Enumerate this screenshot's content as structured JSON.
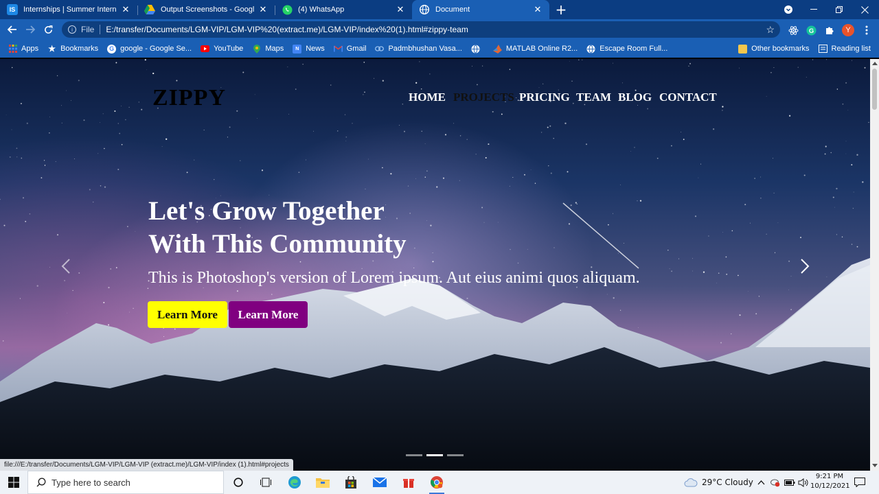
{
  "browser": {
    "tabs": [
      {
        "title": "Internships | Summer Internship",
        "favicon": "IS",
        "favicon_color": "#1e88e5",
        "close": "✕"
      },
      {
        "title": "Output Screenshots - Google Dri",
        "favicon": "drive",
        "favicon_color": "#fbbc04",
        "close": "✕"
      },
      {
        "title": "(4) WhatsApp",
        "favicon": "whatsapp",
        "favicon_color": "#25d366",
        "close": "✕"
      },
      {
        "title": "Document",
        "favicon": "globe",
        "favicon_color": "#ffffff",
        "close": "✕",
        "active": true
      }
    ],
    "new_tab": "+",
    "address": {
      "scheme": "File",
      "url": "E:/transfer/Documents/LGM-VIP/LGM-VIP%20(extract.me)/LGM-VIP/index%20(1).html#zippy-team"
    },
    "profile_initial": "Y",
    "bookmarks": [
      {
        "label": "Apps",
        "icon": "apps-grid-icon"
      },
      {
        "label": "Bookmarks",
        "icon": "star-icon"
      },
      {
        "label": "google - Google Se...",
        "icon": "google-icon"
      },
      {
        "label": "YouTube",
        "icon": "youtube-icon"
      },
      {
        "label": "Maps",
        "icon": "maps-icon"
      },
      {
        "label": "News",
        "icon": "news-icon"
      },
      {
        "label": "Gmail",
        "icon": "gmail-icon"
      },
      {
        "label": "Padmbhushan Vasa...",
        "icon": "link-icon"
      },
      {
        "label": "",
        "icon": "globe-icon"
      },
      {
        "label": "MATLAB Online R2...",
        "icon": "matlab-icon"
      },
      {
        "label": "Escape Room Full...",
        "icon": "globe-icon"
      }
    ],
    "bookmarks_right": [
      {
        "label": "Other bookmarks",
        "icon": "folder-icon"
      },
      {
        "label": "Reading list",
        "icon": "reading-list-icon"
      }
    ],
    "status_url": "file:///E:/transfer/Documents/LGM-VIP/LGM-VIP (extract.me)/LGM-VIP/index (1).html#projects"
  },
  "page": {
    "brand": "ZIPPY",
    "nav": [
      {
        "label": "HOME",
        "active": false
      },
      {
        "label": "PROJECTS",
        "active": true
      },
      {
        "label": "PRICING",
        "active": false
      },
      {
        "label": "TEAM",
        "active": false
      },
      {
        "label": "BLOG",
        "active": false
      },
      {
        "label": "CONTACT",
        "active": false
      }
    ],
    "hero": {
      "title_line1": "Let's Grow Together",
      "title_line2": "With This Community",
      "subtitle": "This is Photoshop's version of Lorem ipsum. Aut eius animi quos aliquam.",
      "primary_button": "Learn More",
      "secondary_button": "Learn More",
      "primary_color": "#ffff00",
      "secondary_color": "#800080"
    },
    "carousel": {
      "slides": 3,
      "active_index": 1
    }
  },
  "taskbar": {
    "search_placeholder": "Type here to search",
    "weather": "29°C  Cloudy",
    "time": "9:21 PM",
    "date": "10/12/2021"
  }
}
